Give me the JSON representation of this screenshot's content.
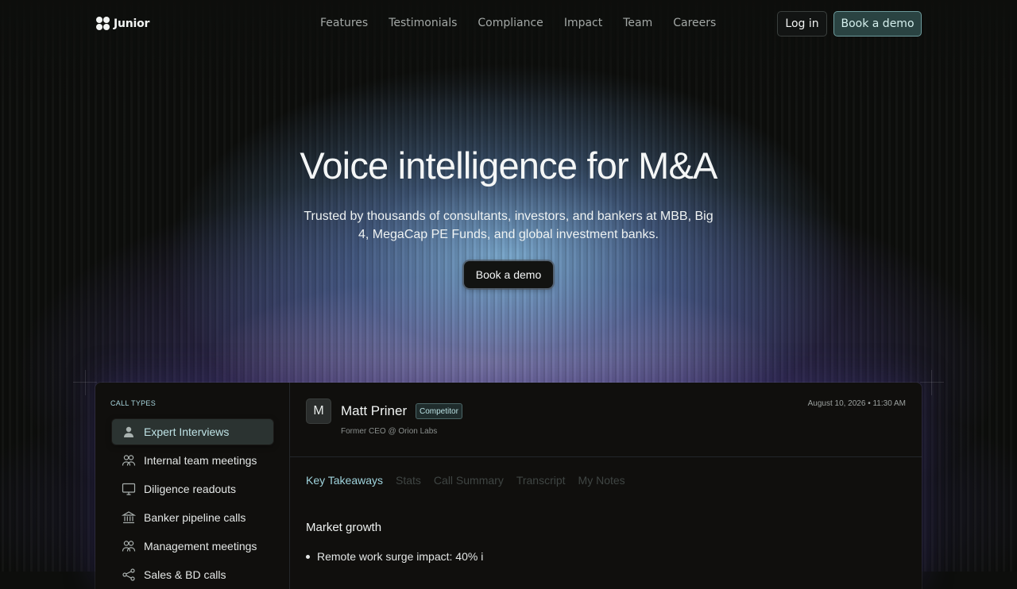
{
  "brand": {
    "name": "Junior"
  },
  "nav": {
    "links": [
      "Features",
      "Testimonials",
      "Compliance",
      "Impact",
      "Team",
      "Careers"
    ],
    "login_label": "Log in",
    "demo_label": "Book a demo"
  },
  "hero": {
    "title": "Voice intelligence for M&A",
    "subtitle": "Trusted by thousands of consultants, investors, and bankers at MBB, Big 4, MegaCap PE Funds, and global investment banks.",
    "cta_label": "Book a demo"
  },
  "app": {
    "sidebar": {
      "heading": "CALL TYPES",
      "items": [
        {
          "label": "Expert Interviews",
          "icon": "user-icon",
          "active": true
        },
        {
          "label": "Internal team meetings",
          "icon": "team-icon",
          "active": false
        },
        {
          "label": "Diligence readouts",
          "icon": "presentation-icon",
          "active": false
        },
        {
          "label": "Banker pipeline calls",
          "icon": "bank-icon",
          "active": false
        },
        {
          "label": "Management meetings",
          "icon": "team-icon",
          "active": false
        },
        {
          "label": "Sales & BD calls",
          "icon": "share-icon",
          "active": false
        }
      ]
    },
    "call": {
      "avatar_initial": "M",
      "name": "Matt Priner",
      "badge": "Competitor",
      "role": "Former CEO @ Orion Labs",
      "date": "August 10, 2026 • 11:30 AM"
    },
    "tabs": [
      "Key Takeaways",
      "Stats",
      "Call Summary",
      "Transcript",
      "My Notes"
    ],
    "active_tab": "Key Takeaways",
    "section_title": "Market growth",
    "bullets": [
      "Remote work surge impact: 40% i"
    ]
  }
}
